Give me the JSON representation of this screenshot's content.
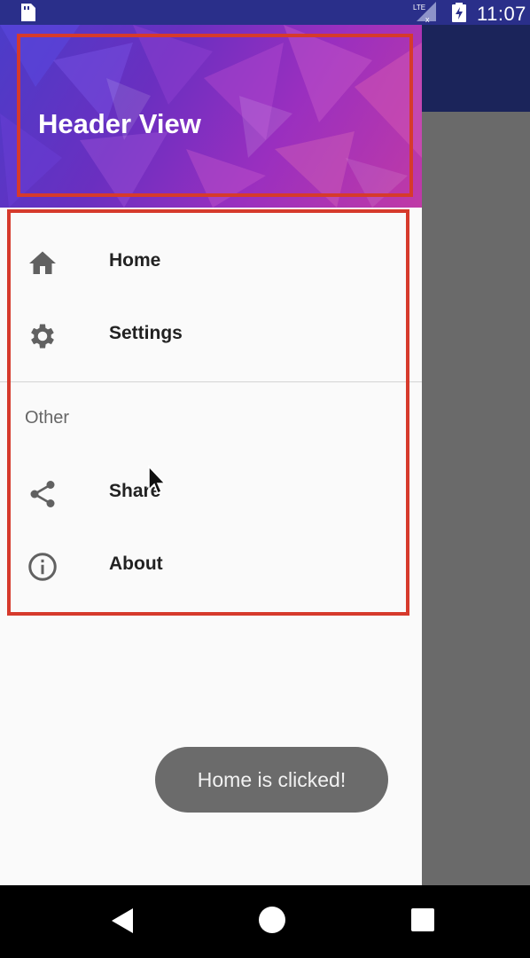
{
  "status_bar": {
    "time": "11:07",
    "network": "LTE",
    "icons": [
      "sim-card-icon",
      "signal-icon",
      "battery-charging-icon"
    ]
  },
  "drawer": {
    "header": {
      "title": "Header View"
    },
    "menu": [
      {
        "label": "Home",
        "icon": "home-icon"
      },
      {
        "label": "Settings",
        "icon": "gear-icon"
      }
    ],
    "section": {
      "title": "Other",
      "items": [
        {
          "label": "Share",
          "icon": "share-icon"
        },
        {
          "label": "About",
          "icon": "info-icon"
        }
      ]
    }
  },
  "toast": {
    "message": "Home is clicked!"
  },
  "navigation": [
    "back-icon",
    "home-circle-icon",
    "recents-icon"
  ],
  "colors": {
    "highlight": "#d63a2c",
    "scrim": "#6a6a6a",
    "toolbar": "#1b245a",
    "status_bar": "#2a2f8a",
    "toast_bg": "#6b6b6b"
  }
}
